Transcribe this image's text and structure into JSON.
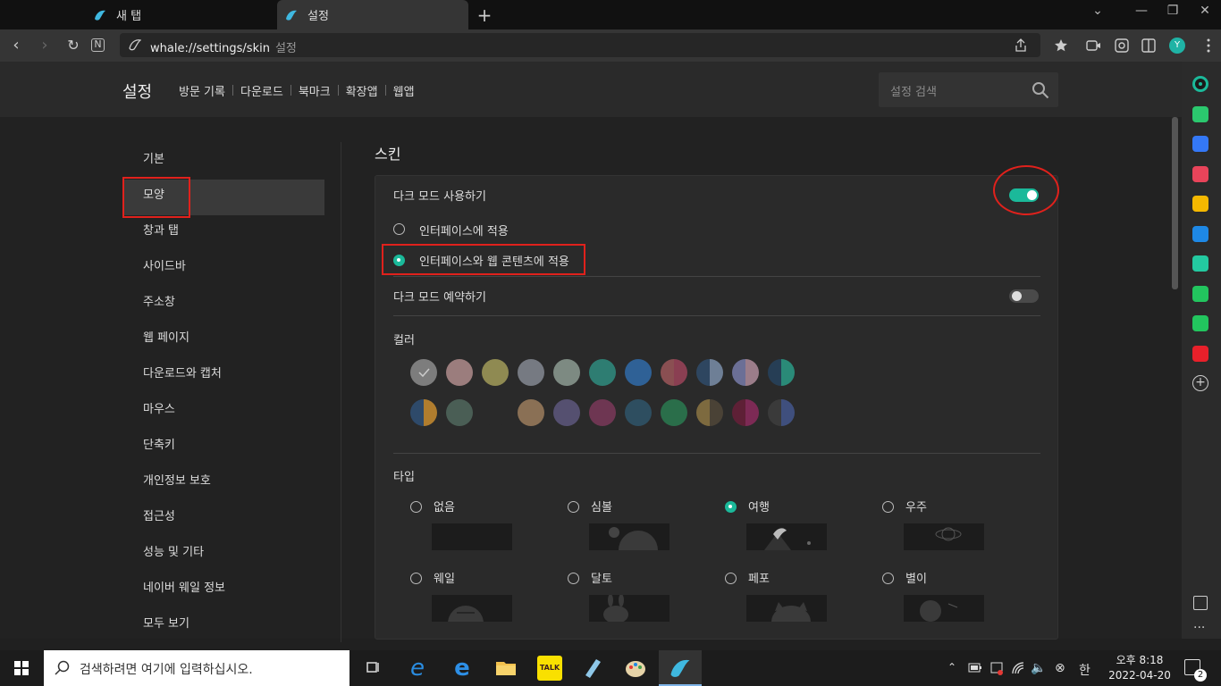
{
  "tabs": [
    {
      "label": "새 탭"
    },
    {
      "label": "설정"
    }
  ],
  "address": {
    "url": "whale://settings/skin",
    "suffix": "설정"
  },
  "avatar": {
    "letter": "Y"
  },
  "header": {
    "title": "설정",
    "nav": [
      "방문 기록",
      "다운로드",
      "북마크",
      "확장앱",
      "웹앱"
    ],
    "search_placeholder": "설정 검색"
  },
  "sidebar": {
    "items": [
      "기본",
      "모양",
      "창과 탭",
      "사이드바",
      "주소창",
      "웹 페이지",
      "다운로드와 캡처",
      "마우스",
      "단축키",
      "개인정보 보호",
      "접근성",
      "성능 및 기타",
      "네이버 웨일 정보",
      "모두 보기"
    ],
    "active_index": 1
  },
  "skin": {
    "title": "스킨",
    "dark_mode": {
      "label": "다크 모드 사용하기",
      "enabled": true
    },
    "apply_options": [
      {
        "label": "인터페이스에 적용",
        "selected": false
      },
      {
        "label": "인터페이스와 웹 콘텐츠에 적용",
        "selected": true
      }
    ],
    "schedule": {
      "label": "다크 모드 예약하기",
      "enabled": false
    },
    "color_label": "컬러",
    "colors_row1": [
      "#7d7d7d",
      "#9b7d7d",
      "#8f8a52",
      "#767a82",
      "#7d8a82",
      "#2e7d72",
      "#2f6196",
      "#8a4f52|#8a3f52",
      "#2e4660|#6e7f96",
      "#6b6f96|#9b7d8a",
      "#263e55|#2a8a78"
    ],
    "colors_row2": [
      "#2e4a6a|#b07d2e",
      "#4a5e55",
      "#2a2a2a",
      "#8a7055",
      "#555070",
      "#6e3652",
      "#2e4e60",
      "#2a6e4a",
      "#7d6a3f|#4a4236",
      "#5e2036|#7d2a55",
      "#3a3a3a|#3f4f7d"
    ],
    "type_label": "타입",
    "types": [
      {
        "label": "없음",
        "selected": false
      },
      {
        "label": "심볼",
        "selected": false
      },
      {
        "label": "여행",
        "selected": true
      },
      {
        "label": "우주",
        "selected": false
      },
      {
        "label": "웨일",
        "selected": false
      },
      {
        "label": "달토",
        "selected": false
      },
      {
        "label": "페포",
        "selected": false
      },
      {
        "label": "별이",
        "selected": false
      }
    ]
  },
  "sidebar_apps": [
    "#1bb99a",
    "#2bc86e",
    "#3478f6",
    "#e8445a",
    "#f5b800",
    "#1e88e5",
    "#23c9a0",
    "#22c55e",
    "#22c55e",
    "#e8202a",
    "#888888"
  ],
  "taskbar": {
    "search_placeholder": "검색하려면 여기에 입력하십시오.",
    "time": "오후 8:18",
    "date": "2022-04-20",
    "ime": "한",
    "notifications": "2"
  }
}
